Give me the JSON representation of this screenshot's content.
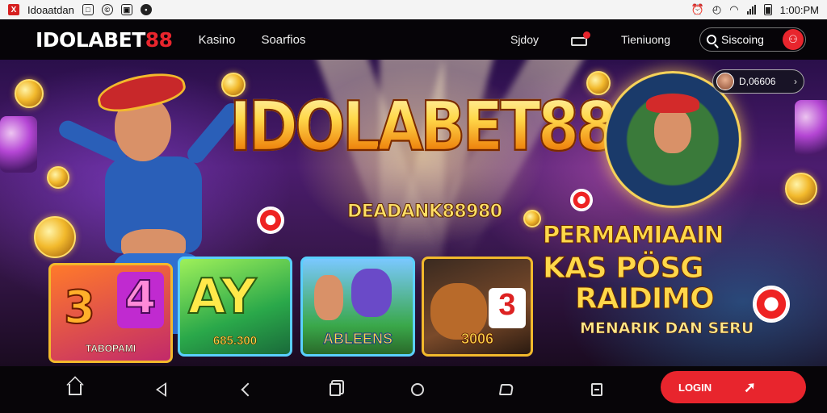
{
  "statusbar": {
    "app_title": "Idoaatdan",
    "time": "1:00:PM",
    "icons": [
      "app-x-icon",
      "notification-icon",
      "whatsapp-icon",
      "gallery-icon",
      "dot-icon",
      "alarm-icon",
      "clock-icon",
      "wifi-icon",
      "signal-icon",
      "battery-icon"
    ]
  },
  "nav": {
    "logo_main": "IDOLABET",
    "logo_num": "88",
    "links": [
      "Kasino",
      "Soarfios"
    ],
    "right_links": [
      "Sjdoy",
      "Tieniuong"
    ],
    "search_label": "Siscoing",
    "colors": {
      "accent": "#e8252d",
      "background": "#060408"
    }
  },
  "hero": {
    "title": "IDOLABET88",
    "subtitle": "DEADANK88980",
    "balance": "D,06606",
    "tiles": [
      {
        "text_a": "3",
        "text_b": "4",
        "label": "TABOPAMI"
      },
      {
        "text_a": "AY",
        "label": "685.300"
      },
      {
        "label": "ABLEENS"
      },
      {
        "text_a": "3",
        "label": "3006"
      }
    ],
    "promo": {
      "line1": "PERMAMIAAIN",
      "line2a": "KAS PÖSG",
      "line2b": "RAIDIMO",
      "line3": "MENARIK DAN SERU"
    }
  },
  "bottombar": {
    "icons": [
      "home-icon",
      "back-icon",
      "chevron-left-icon",
      "copy-icon",
      "circle-icon",
      "share-icon",
      "note-icon"
    ],
    "login_label": "LOGIN",
    "login_arrow": "➚"
  }
}
